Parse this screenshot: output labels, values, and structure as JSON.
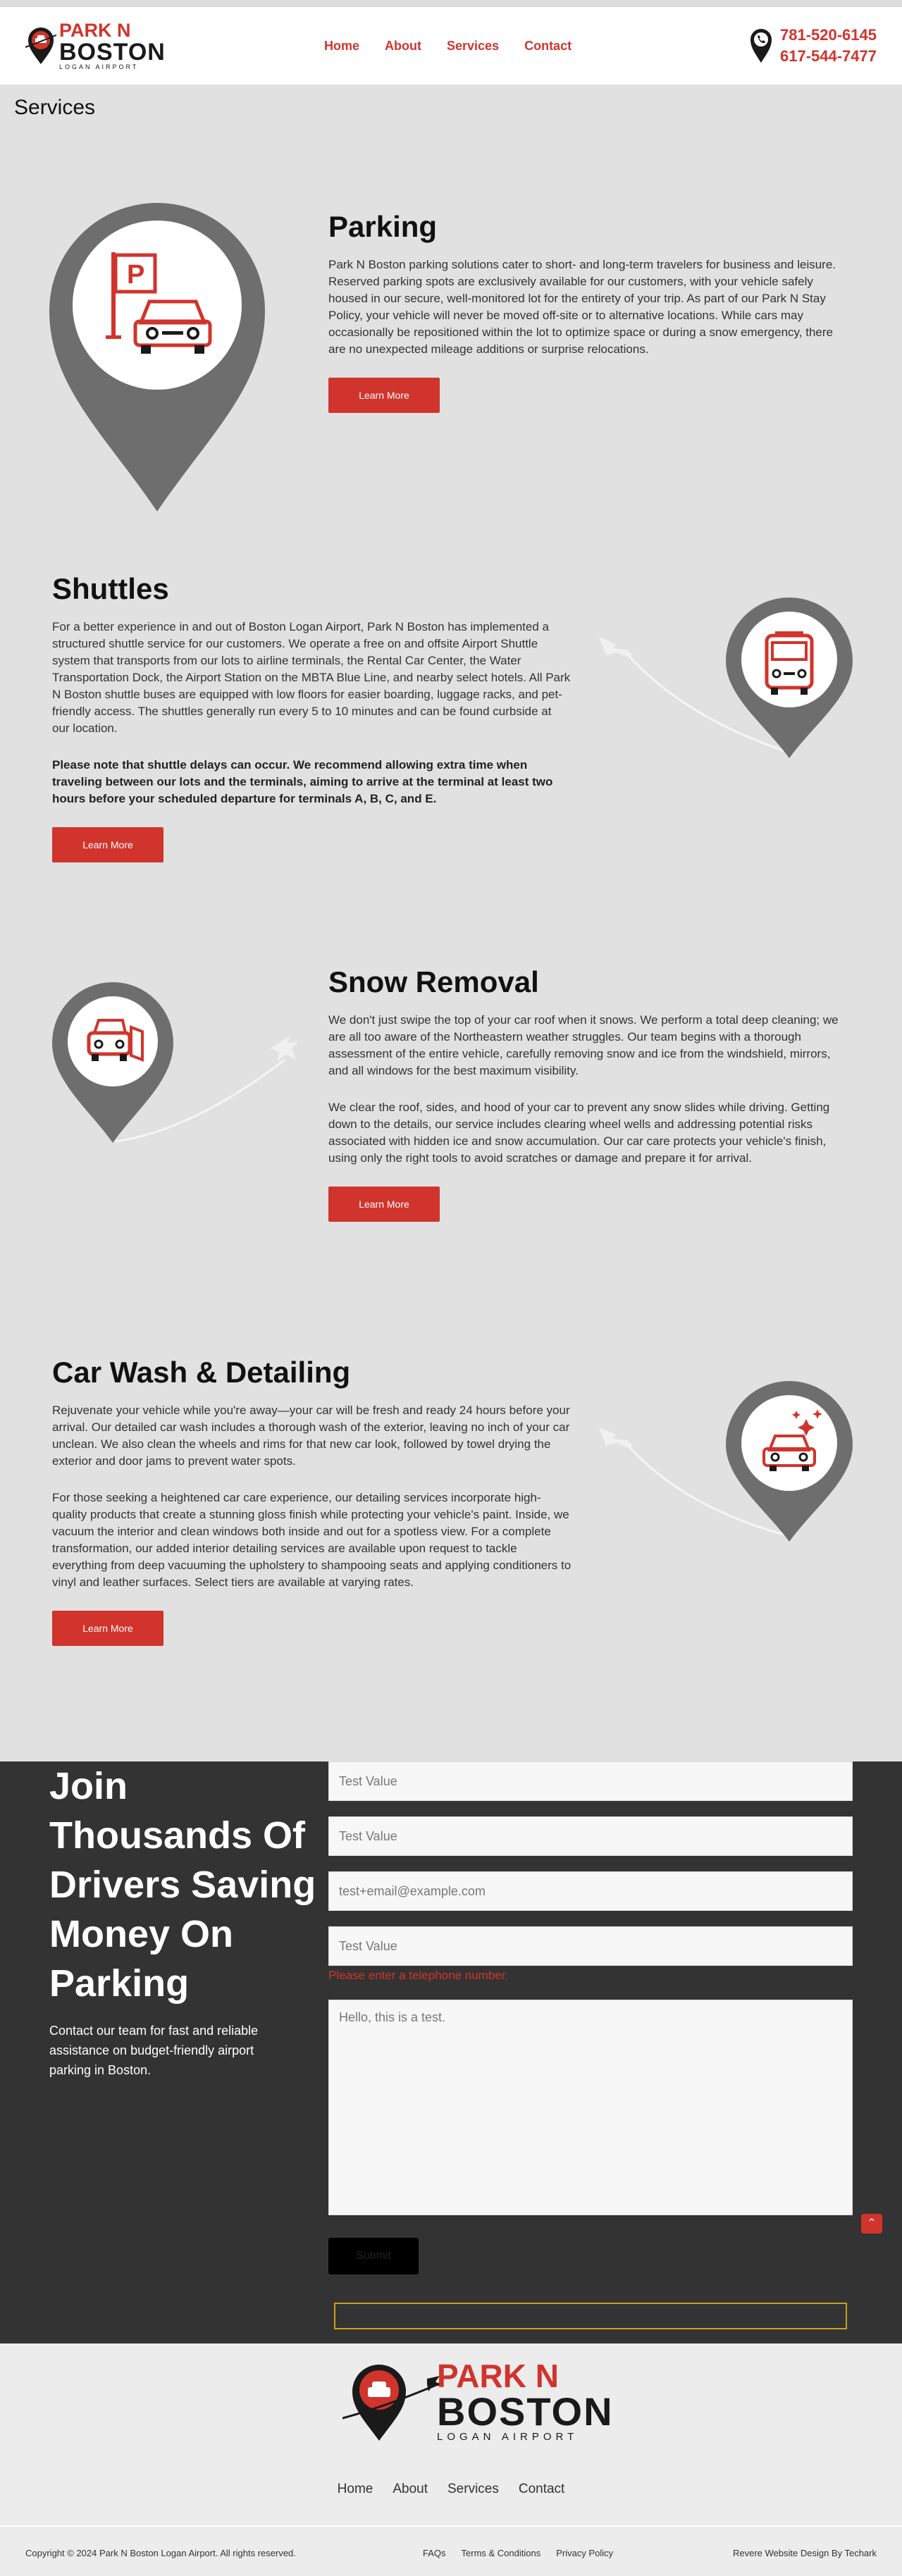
{
  "colors": {
    "brand_red": "#d0342c",
    "dark": "#333333",
    "bg": "#e1e1e1"
  },
  "header": {
    "logo": {
      "park": "PARK N",
      "boston": "BOSTON",
      "sub": "LOGAN AIRPORT"
    },
    "nav": [
      "Home",
      "About",
      "Services",
      "Contact"
    ],
    "phones": [
      "781-520-6145",
      "617-544-7477"
    ]
  },
  "page_title": "Services",
  "services": {
    "parking": {
      "title": "Parking",
      "paragraphs": [
        "Park N Boston parking solutions cater to short- and long-term travelers for business and leisure. Reserved parking spots are exclusively available for our customers, with your vehicle safely housed in our secure, well-monitored lot for the entirety of your trip. As part of our Park N Stay Policy, your vehicle will never be moved off-site or to alternative locations. While cars may occasionally be repositioned within the lot to optimize space or during a snow emergency, there are no unexpected mileage additions or surprise relocations."
      ],
      "button": "Learn More"
    },
    "shuttles": {
      "title": "Shuttles",
      "paragraphs": [
        "For a better experience in and out of Boston Logan Airport, Park N Boston has implemented a structured shuttle service for our customers. We operate a free on and offsite Airport Shuttle system that transports from our lots to airline terminals, the Rental Car Center, the Water Transportation Dock, the Airport Station on the MBTA Blue Line, and nearby select hotels. All Park N Boston shuttle buses are equipped with low floors for easier boarding, luggage racks, and pet-friendly access. The shuttles generally run every 5 to 10 minutes and can be found curbside at our location.",
        "Please note that shuttle delays can occur. We recommend allowing extra time when traveling between our lots and the terminals, aiming to arrive at the terminal at least two hours before your scheduled departure for terminals A, B, C, and E."
      ],
      "button": "Learn More"
    },
    "snow": {
      "title": "Snow Removal",
      "paragraphs": [
        "We don't just swipe the top of your car roof when it snows. We perform a total deep cleaning; we are all too aware of the Northeastern weather struggles. Our team begins with a thorough assessment of the entire vehicle, carefully removing snow and ice from the windshield, mirrors, and all windows for the best maximum visibility.",
        "We clear the roof, sides, and hood of your car to prevent any snow slides while driving. Getting down to the details, our service includes clearing wheel wells and addressing potential risks associated with hidden ice and snow accumulation. Our car care protects your vehicle's finish, using only the right tools to avoid scratches or damage and prepare it for arrival."
      ],
      "button": "Learn More"
    },
    "carwash": {
      "title": "Car Wash & Detailing",
      "paragraphs": [
        "Rejuvenate your vehicle while you're away—your car will be fresh and ready 24 hours before your arrival. Our detailed car wash includes a thorough wash of the exterior, leaving no inch of your car unclean. We also clean the wheels and rims for that new car look, followed by towel drying the exterior and door jams to prevent water spots.",
        "For those seeking a heightened car care experience, our detailing services incorporate high-quality products that create a stunning gloss finish while protecting your vehicle's paint. Inside, we vacuum the interior and clean windows both inside and out for a spotless view. For a complete transformation, our added interior detailing services are available upon request to tackle everything from deep vacuuming the upholstery to shampooing seats and applying conditioners to vinyl and leather surfaces. Select tiers are available at varying rates."
      ],
      "button": "Learn More"
    }
  },
  "contact": {
    "heading": "Join Thousands Of Drivers Saving Money On Parking",
    "blurb": "Contact our team for fast and reliable assistance on budget-friendly airport parking in Boston.",
    "fields": [
      "Test Value",
      "Test Value",
      "test+email@example.com",
      "Test Value"
    ],
    "error": "Please enter a telephone number.",
    "message": "Hello, this is a test.",
    "submit": "Submit"
  },
  "footer": {
    "logo": {
      "park": "PARK N",
      "boston": "BOSTON",
      "sub": "LOGAN AIRPORT"
    },
    "nav": [
      "Home",
      "About",
      "Services",
      "Contact"
    ],
    "copyright": "Copyright © 2024 Park N Boston Logan Airport. All rights reserved.",
    "links": [
      "FAQs",
      "Terms & Conditions",
      "Privacy Policy"
    ],
    "credit": "Revere Website Design By Techark"
  }
}
